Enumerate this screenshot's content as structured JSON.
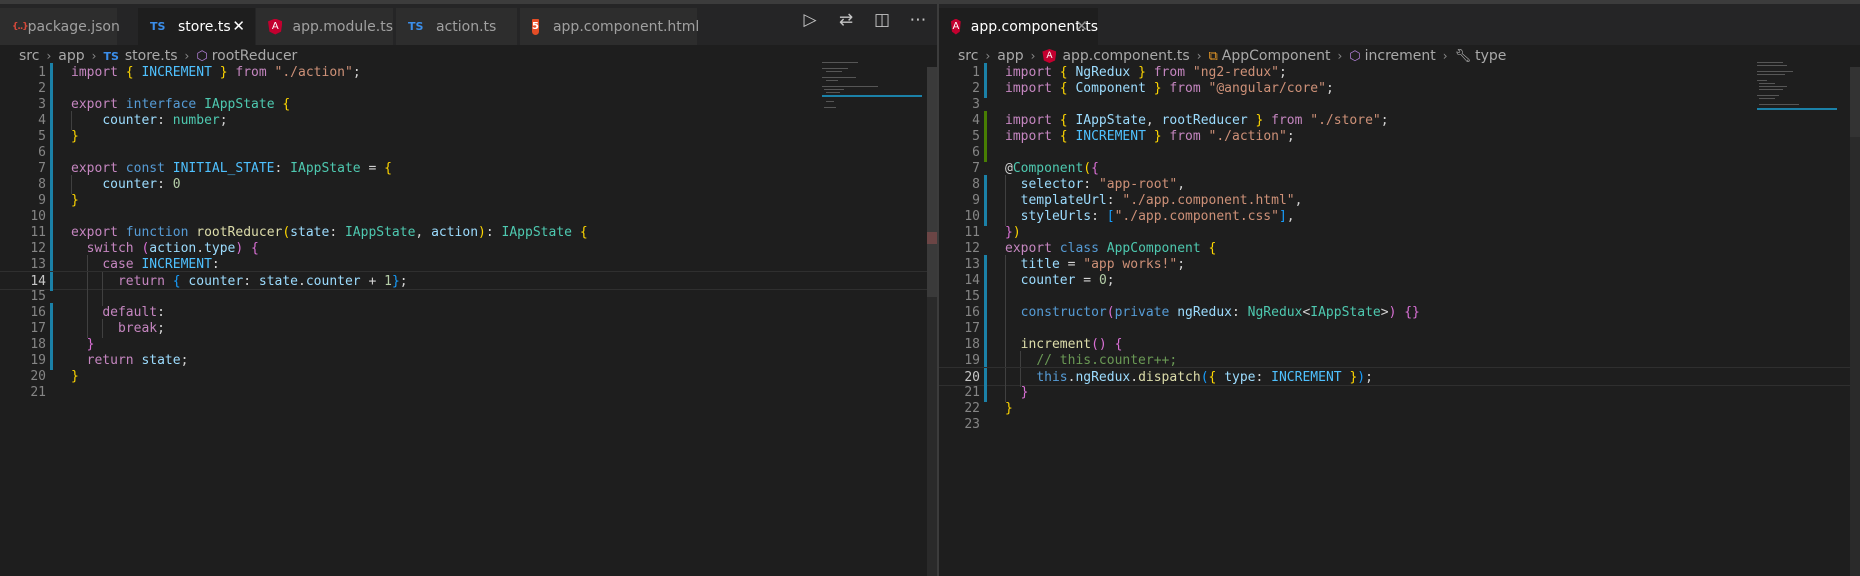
{
  "left_pane": {
    "tabs": [
      {
        "label": "package.json",
        "icon": "json-file-icon",
        "active": false
      },
      {
        "label": "store.ts",
        "icon": "ts-file-icon",
        "active": true
      },
      {
        "label": "app.module.ts",
        "icon": "angular-icon",
        "active": false
      },
      {
        "label": "action.ts",
        "icon": "ts-file-icon",
        "active": false
      },
      {
        "label": "app.component.html",
        "icon": "html5-icon",
        "active": false
      }
    ],
    "breadcrumb": [
      "src",
      "app",
      "store.ts",
      "rootReducer"
    ],
    "current_line": 14,
    "lines": [
      {
        "n": "1",
        "text": "import { INCREMENT } from \"./action\";"
      },
      {
        "n": "2",
        "text": ""
      },
      {
        "n": "3",
        "text": "export interface IAppState {"
      },
      {
        "n": "4",
        "text": "    counter: number;"
      },
      {
        "n": "5",
        "text": "}"
      },
      {
        "n": "6",
        "text": ""
      },
      {
        "n": "7",
        "text": "export const INITIAL_STATE: IAppState = {"
      },
      {
        "n": "8",
        "text": "    counter: 0"
      },
      {
        "n": "9",
        "text": "}"
      },
      {
        "n": "10",
        "text": ""
      },
      {
        "n": "11",
        "text": "export function rootReducer(state: IAppState, action): IAppState {"
      },
      {
        "n": "12",
        "text": "  switch (action.type) {"
      },
      {
        "n": "13",
        "text": "    case INCREMENT:"
      },
      {
        "n": "14",
        "text": "      return { counter: state.counter + 1};"
      },
      {
        "n": "15",
        "text": ""
      },
      {
        "n": "16",
        "text": "    default:"
      },
      {
        "n": "17",
        "text": "      break;"
      },
      {
        "n": "18",
        "text": "  }"
      },
      {
        "n": "19",
        "text": "  return state;"
      },
      {
        "n": "20",
        "text": "}"
      },
      {
        "n": "21",
        "text": ""
      }
    ]
  },
  "right_pane": {
    "tabs": [
      {
        "label": "app.component.ts",
        "icon": "angular-icon",
        "active": true
      }
    ],
    "breadcrumb": [
      "src",
      "app",
      "app.component.ts",
      "AppComponent",
      "increment",
      "type"
    ],
    "current_line": 20,
    "lines": [
      {
        "n": "1",
        "text": "import { NgRedux } from \"ng2-redux\";"
      },
      {
        "n": "2",
        "text": "import { Component } from \"@angular/core\";"
      },
      {
        "n": "3",
        "text": ""
      },
      {
        "n": "4",
        "text": "import { IAppState, rootReducer } from \"./store\";"
      },
      {
        "n": "5",
        "text": "import { INCREMENT } from \"./action\";"
      },
      {
        "n": "6",
        "text": ""
      },
      {
        "n": "7",
        "text": "@Component({"
      },
      {
        "n": "8",
        "text": "  selector: \"app-root\","
      },
      {
        "n": "9",
        "text": "  templateUrl: \"./app.component.html\","
      },
      {
        "n": "10",
        "text": "  styleUrls: [\"./app.component.css\"],"
      },
      {
        "n": "11",
        "text": "})"
      },
      {
        "n": "12",
        "text": "export class AppComponent {"
      },
      {
        "n": "13",
        "text": "  title = \"app works!\";"
      },
      {
        "n": "14",
        "text": "  counter = 0;"
      },
      {
        "n": "15",
        "text": ""
      },
      {
        "n": "16",
        "text": "  constructor(private ngRedux: NgRedux<IAppState>) {}"
      },
      {
        "n": "17",
        "text": ""
      },
      {
        "n": "18",
        "text": "  increment() {"
      },
      {
        "n": "19",
        "text": "    // this.counter++;"
      },
      {
        "n": "20",
        "text": "    this.ngRedux.dispatch({ type: INCREMENT });"
      },
      {
        "n": "21",
        "text": "  }"
      },
      {
        "n": "22",
        "text": "}"
      },
      {
        "n": "23",
        "text": ""
      }
    ]
  },
  "theme": {
    "background": "#1e1e1e",
    "tab_bar": "#252526",
    "keyword": "#569cd6",
    "control": "#c586c0",
    "string": "#ce9178",
    "type": "#4ec9b0",
    "function": "#dcdcaa",
    "variable": "#9cdcfe",
    "modified_gutter": "#1b81a8",
    "added_gutter": "#487e02"
  }
}
